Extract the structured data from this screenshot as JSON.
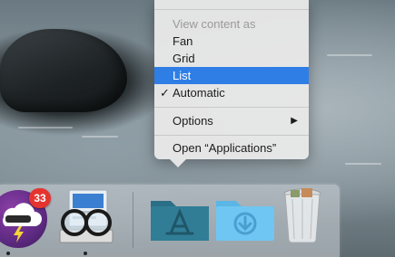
{
  "menu": {
    "header": "View content as",
    "items": [
      {
        "label": "Fan",
        "selected": false,
        "checked": false
      },
      {
        "label": "Grid",
        "selected": false,
        "checked": false
      },
      {
        "label": "List",
        "selected": true,
        "checked": false
      },
      {
        "label": "Automatic",
        "selected": false,
        "checked": true
      }
    ],
    "options_label": "Options",
    "open_label": "Open “Applications”"
  },
  "dock": {
    "badge_count": "33",
    "colors": {
      "selection": "#2f7ee6",
      "folder_apps": "#2b6f86",
      "folder_downloads": "#6fc6f2",
      "badge": "#e5342f"
    }
  }
}
